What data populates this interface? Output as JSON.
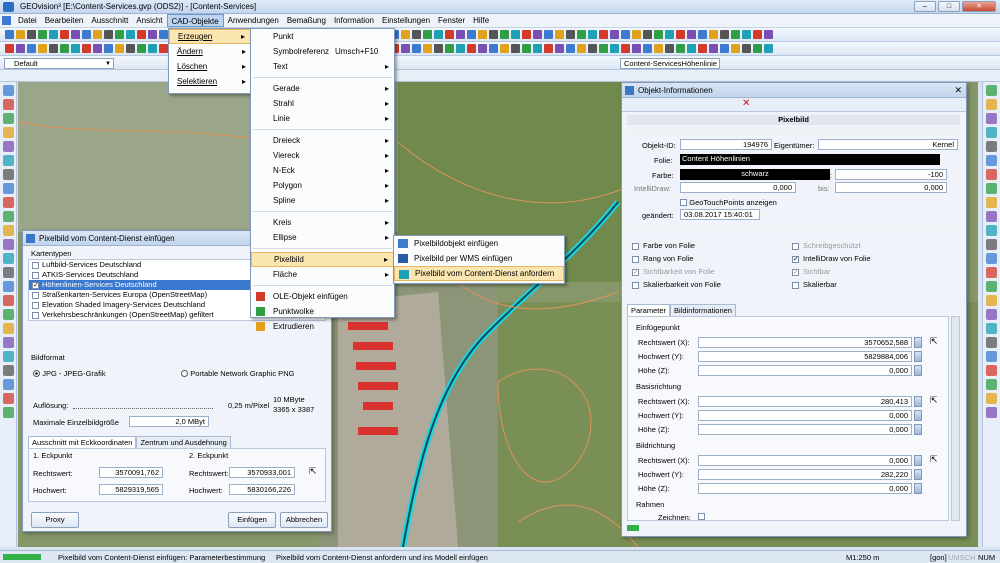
{
  "app": {
    "title": "GEOvision³  [E:\\Content-Services.gvp (ODS2)] - [Content-Services]"
  },
  "menu": [
    "Datei",
    "Bearbeiten",
    "Ausschnitt",
    "Ansicht",
    "CAD-Objekte",
    "Anwendungen",
    "Bemaßung",
    "Information",
    "Einstellungen",
    "Fenster",
    "Hilfe"
  ],
  "toolbar": {
    "layer_value": "Default",
    "layer_select": "Content-ServicesHöhenlinie"
  },
  "cad_menu": [
    "Erzeugen",
    "Ändern",
    "Löschen",
    "Selektieren"
  ],
  "create_menu": [
    {
      "label": "Punkt",
      "shortcut": "",
      "sub": false
    },
    {
      "label": "Symbolreferenz",
      "shortcut": "Umsch+F10",
      "sub": false
    },
    {
      "label": "Text",
      "shortcut": "",
      "sub": true
    },
    {
      "label": "Gerade",
      "shortcut": "",
      "sub": true
    },
    {
      "label": "Strahl",
      "shortcut": "",
      "sub": true
    },
    {
      "label": "Linie",
      "shortcut": "",
      "sub": true
    },
    {
      "label": "Dreieck",
      "shortcut": "",
      "sub": true
    },
    {
      "label": "Viereck",
      "shortcut": "",
      "sub": true
    },
    {
      "label": "N-Eck",
      "shortcut": "",
      "sub": true
    },
    {
      "label": "Polygon",
      "shortcut": "",
      "sub": true
    },
    {
      "label": "Spline",
      "shortcut": "",
      "sub": true
    },
    {
      "label": "Kreis",
      "shortcut": "",
      "sub": true
    },
    {
      "label": "Ellipse",
      "shortcut": "",
      "sub": true
    },
    {
      "label": "Pixelbild",
      "shortcut": "",
      "sub": true
    },
    {
      "label": "Fläche",
      "shortcut": "",
      "sub": true
    },
    {
      "label": "OLE-Objekt einfügen",
      "shortcut": "",
      "sub": false
    },
    {
      "label": "Punktwolke",
      "shortcut": "",
      "sub": false
    },
    {
      "label": "Extrudieren",
      "shortcut": "",
      "sub": false
    }
  ],
  "pixel_menu": [
    "Pixelbildobjekt einfügen",
    "Pixelbild per WMS einfügen",
    "Pixelbild vom Content-Dienst anfordern"
  ],
  "dialog": {
    "title": "Pixelbild vom Content-Dienst einfügen",
    "group_maps": "Kartentypen",
    "maps": [
      {
        "label": "Luftbild-Services Deutschland",
        "checked": false
      },
      {
        "label": "ATKIS-Services Deutschland",
        "checked": false
      },
      {
        "label": "Höhenlinien-Services Deutschland",
        "checked": true
      },
      {
        "label": "Straßenkarten-Services Europa (OpenStreetMap)",
        "checked": false
      },
      {
        "label": "Elevation Shaded Imagery-Services Deutschland",
        "checked": false
      },
      {
        "label": "Verkehrsbeschränkungen (OpenStreetMap) gefiltert",
        "checked": false
      }
    ],
    "group_format": "Bildformat",
    "fmt_jpg": "JPG - JPEG-Grafik",
    "fmt_png": "Portable Network Graphic PNG",
    "resolution_label": "Auflösung:",
    "resolution_value": "0,25 m/Pixel",
    "size_label": "Maximale Einzelbildgröße",
    "size_value": "2,0 MByt",
    "info_mb": "10 MByte",
    "info_px": "3365 x 3387",
    "tab1": "Ausschnitt mit Eckkoordinaten",
    "tab2": "Zentrum und Ausdehnung",
    "c1": "1. Eckpunkt",
    "c2": "2. Eckpunkt",
    "rw": "Rechtswert:",
    "hw": "Hochwert:",
    "c1_rw": "3570091,762",
    "c1_hw": "5829319,565",
    "c2_rw": "3570933,001",
    "c2_hw": "5830166,226",
    "proxy": "Proxy",
    "insert": "Einfügen",
    "cancel": "Abbrechen"
  },
  "info": {
    "title": "Objekt-Informationen",
    "header": "Pixelbild",
    "id_label": "Objekt-ID:",
    "id_value": "194976",
    "owner_label": "Eigentümer:",
    "owner_value": "Kernel",
    "folie_label": "Folie:",
    "folie_value": "Content Höhenlinien",
    "farbe_label": "Farbe:",
    "farbe_value": "schwarz",
    "rang_label": "Rang:",
    "rang_value": "-100",
    "intelli_label": "IntelliDraw:",
    "intelli_value": "0,000",
    "bis_label": "bis:",
    "bis_value": "0,000",
    "geotouch": "GeoTouchPoints anzeigen",
    "geaendert_label": "geändert:",
    "geaendert_value": "03.08.2017 15:40:01",
    "checks": [
      {
        "label": "Farbe von Folie",
        "checked": false,
        "disabled": false
      },
      {
        "label": "Schreibgeschützt",
        "checked": false,
        "disabled": true
      },
      {
        "label": "Rang von Folie",
        "checked": false,
        "disabled": false
      },
      {
        "label": "IntelliDraw von Folie",
        "checked": true,
        "disabled": false
      },
      {
        "label": "Sichtbarkeit von Folie",
        "checked": true,
        "disabled": true
      },
      {
        "label": "Sichtbar",
        "checked": true,
        "disabled": true
      },
      {
        "label": "Skalierbarkeit von Folie",
        "checked": false,
        "disabled": false
      },
      {
        "label": "Skalierbar",
        "checked": false,
        "disabled": false
      }
    ],
    "tab1": "Parameter",
    "tab2": "Bildinformationen",
    "g1": "Einfügepunkt",
    "g2": "Basisrichtung",
    "g3": "Bildrichtung",
    "g4": "Rahmen",
    "rw": "Rechtswert (X):",
    "hw": "Hochwert (Y):",
    "hz": "Höhe (Z):",
    "ep": [
      "3570652,588",
      "5829884,006",
      "0,000"
    ],
    "br": [
      "280,413",
      "0,000",
      "0,000"
    ],
    "bi": [
      "0,000",
      "282,220",
      "0,000"
    ],
    "zeichnen": "Zeichnen:"
  },
  "status": {
    "left": "Pixelbild vom Content-Dienst einfügen: Parameterbestimmung",
    "hint": "Pixelbild vom Content-Dienst anfordern und ins Modell einfügen",
    "scale": "M1:250  m",
    "gon": "[gon]",
    "umsch": "UMSCH",
    "num": "NUM"
  }
}
